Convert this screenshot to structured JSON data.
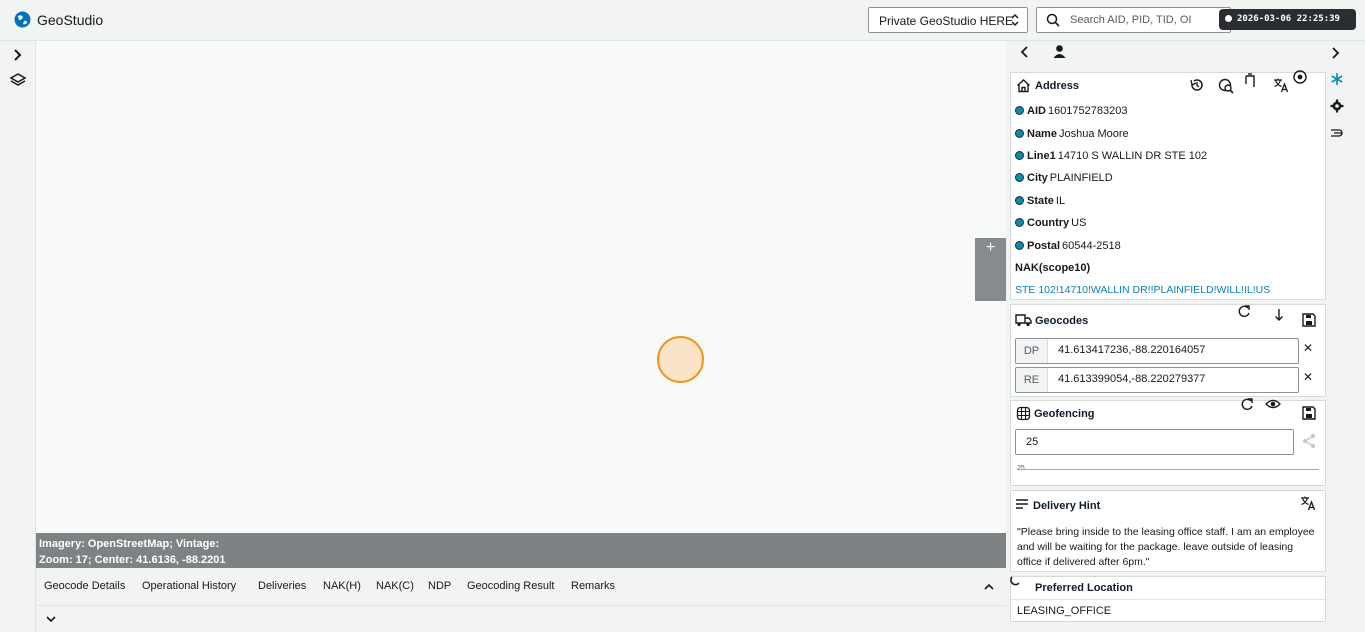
{
  "app": {
    "title": "GeoStudio"
  },
  "header": {
    "source_select": "Private GeoStudio HERE",
    "search_placeholder": "Search AID, PID, TID, OI",
    "clock": "2026-03-06 22:25:39"
  },
  "map": {
    "imagery": "Imagery: OpenStreetMap; Vintage:",
    "zoom_center": "Zoom: 17; Center: 41.6136, -88.2201",
    "zoom_in_label": "+"
  },
  "tabs": [
    "Geocode Details",
    "Operational History",
    "Deliveries",
    "NAK(H)",
    "NAK(C)",
    "NDP",
    "Geocoding Result",
    "Remarks"
  ],
  "address": {
    "title": "Address",
    "fields": [
      {
        "label": "AID",
        "value": "1601752783203"
      },
      {
        "label": "Name",
        "value": "Joshua Moore"
      },
      {
        "label": "Line1",
        "value": "14710 S WALLIN DR STE 102"
      },
      {
        "label": "City",
        "value": "PLAINFIELD"
      },
      {
        "label": "State",
        "value": "IL"
      },
      {
        "label": "Country",
        "value": "US"
      },
      {
        "label": "Postal",
        "value": "60544-2518"
      }
    ],
    "nak_label": "NAK(scope10)",
    "nak_value": "STE 102!14710!WALLIN DR!!PLAINFIELD!WILL!IL!US"
  },
  "geocodes": {
    "title": "Geocodes",
    "rows": [
      {
        "prefix": "DP",
        "value": "41.613417236,-88.220164057"
      },
      {
        "prefix": "RE",
        "value": "41.613399054,-88.220279377"
      }
    ],
    "close_label": "✕"
  },
  "geofencing": {
    "title": "Geofencing",
    "value": "25",
    "slider_label": "25",
    "radius": 25
  },
  "delivery_hint": {
    "title": "Delivery Hint",
    "text": "\"Please bring inside to the leasing office staff. I am an employee and will be waiting for the package. leave outside of leasing office if delivered after 6pm.\""
  },
  "preferred_location": {
    "title": "Preferred Location",
    "value": "LEASING_OFFICE"
  },
  "colors": {
    "accent": "#0b8da8",
    "marker_stroke": "#f0971b",
    "marker_fill": "#fbe3c9",
    "link": "#0b7fb5"
  }
}
